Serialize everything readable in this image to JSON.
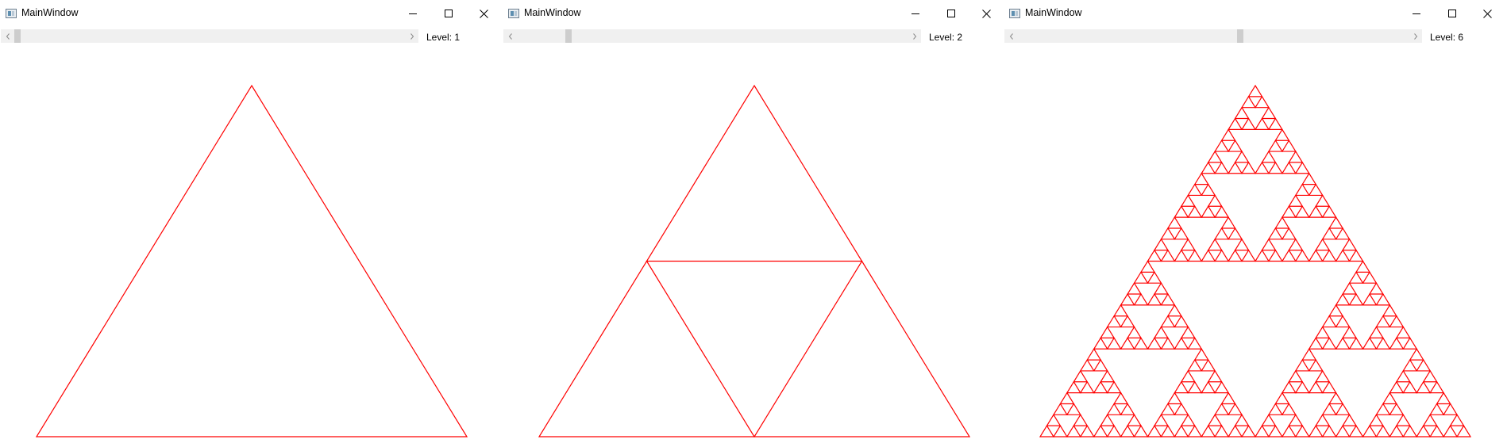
{
  "windows": [
    {
      "title": "MainWindow",
      "level_text": "Level: 1",
      "level": 1,
      "slider_fraction": 0.0,
      "icon": "app-window-icon"
    },
    {
      "title": "MainWindow",
      "level_text": "Level: 2",
      "level": 2,
      "slider_fraction": 0.125,
      "icon": "app-window-icon"
    },
    {
      "title": "MainWindow",
      "level_text": "Level: 6",
      "level": 6,
      "slider_fraction": 0.57,
      "icon": "app-window-icon"
    }
  ],
  "caption_buttons": [
    "minimize-icon",
    "maximize-icon",
    "close-icon"
  ],
  "colors": {
    "fractal_stroke": "#ff0000",
    "scrollbar_track": "#f0f0f0",
    "scrollbar_thumb": "#cdcdcd",
    "background": "#ffffff"
  }
}
